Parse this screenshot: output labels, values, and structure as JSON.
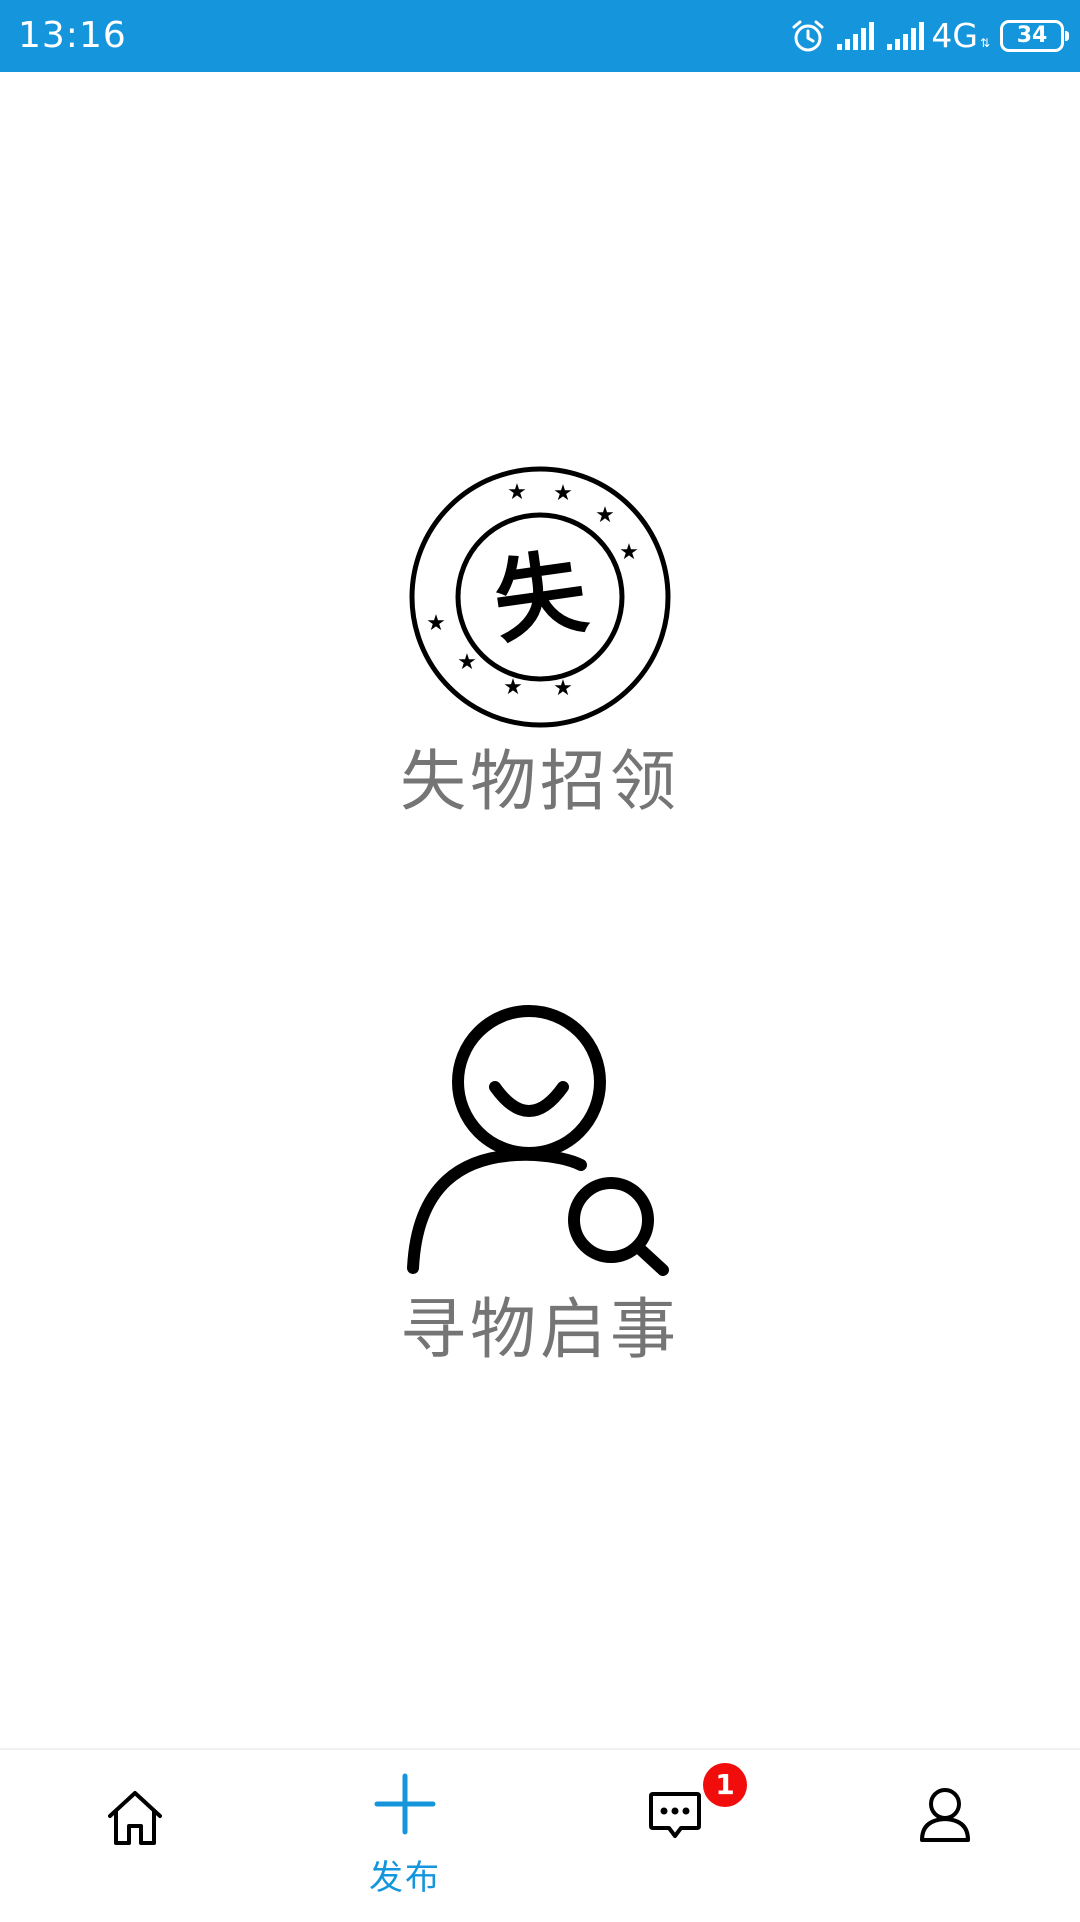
{
  "status_bar": {
    "time": "13:16",
    "network": "4G",
    "network_arrows": "⇅",
    "battery": "34",
    "icons": [
      "alarm-icon",
      "signal-icon",
      "signal-icon",
      "battery-icon"
    ]
  },
  "options": [
    {
      "label": "失物招领",
      "icon": "lost-stamp-icon",
      "stamp_char": "失"
    },
    {
      "label": "寻物启事",
      "icon": "person-search-icon"
    }
  ],
  "tab_bar": {
    "tabs": [
      {
        "icon": "home-icon",
        "label": ""
      },
      {
        "icon": "plus-icon",
        "label": "发布",
        "active": true
      },
      {
        "icon": "message-icon",
        "label": "",
        "badge": "1"
      },
      {
        "icon": "user-icon",
        "label": ""
      }
    ]
  },
  "colors": {
    "accent": "#1596dc",
    "badge": "#f20d0d",
    "label": "#757575"
  }
}
